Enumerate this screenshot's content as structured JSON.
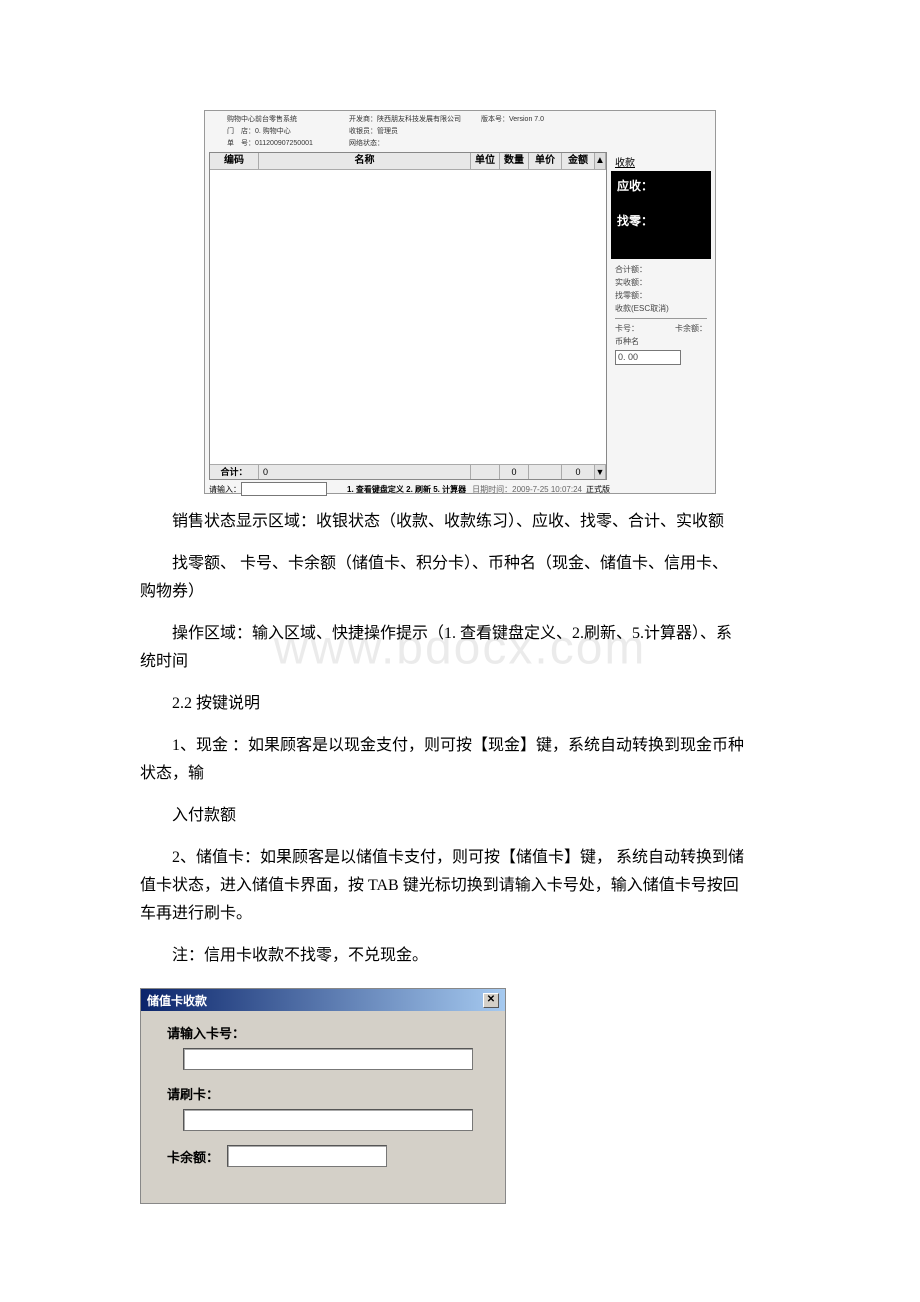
{
  "pos": {
    "header": {
      "sys_label": "购物中心前台零售系统",
      "store_label": "门　店：",
      "store_value": "0. 购物中心",
      "bill_label": "单　号：",
      "bill_value": "011200907250001",
      "dev_label": "开发商：",
      "dev_value": "陕西朋友科技发展有限公司",
      "cashier_label": "收银员：",
      "cashier_value": "管理员",
      "net_label": "网络状态：",
      "ver_label": "版本号：",
      "ver_value": "Version 7.0"
    },
    "grid": {
      "head": {
        "code": "编码",
        "name": "名称",
        "unit": "单位",
        "qty": "数量",
        "price": "单价",
        "amount": "金额"
      },
      "foot": {
        "total_label": "合计：",
        "total_qty": "0",
        "total_mid": "0",
        "total_amt": "0"
      }
    },
    "right": {
      "receipt_title": "收款",
      "due_label": "应收：",
      "change_label": "找零：",
      "sum_label": "合计额：",
      "paid_label": "实收额：",
      "chg_label": "找零额：",
      "pay_hint": "收款(ESC取消)",
      "card_no_label": "卡号：",
      "card_bal_label": "卡余额：",
      "currency_label": "币种名",
      "input_value": "0. 00"
    },
    "bottom": {
      "input_label": "请输入：",
      "hints": "1. 查看键盘定义  2. 刷新  5. 计算器",
      "time_label": "日期时间：",
      "time_value": "2009-7-25 10:07:24",
      "edition": "正式版"
    }
  },
  "paras": {
    "p1": "销售状态显示区域：收银状态（收款、收款练习）、应收、找零、合计、实收额",
    "p2a": "找零额、 卡号、卡余额（储值卡、积分卡）、币种名（现金、储值卡、信用卡、",
    "p2b": "购物券）",
    "p3a": "操作区域：输入区域、快捷操作提示（1. 查看键盘定义、2.刷新、5.计算器）、系",
    "p3b": "统时间",
    "p4": "2.2 按键说明",
    "p5a": "1、现金 ：如果顾客是以现金支付，则可按【现金】键，系统自动转换到现金币种",
    "p5b": "状态，输",
    "p6": " 入付款额",
    "p7a": "2、储值卡：如果顾客是以储值卡支付，则可按【储值卡】键， 系统自动转换到储",
    "p7b": "值卡状态，进入储值卡界面，按 TAB 键光标切换到请输入卡号处，输入储值卡号按回",
    "p7c": "车再进行刷卡。",
    "p8": "注：信用卡收款不找零，不兑现金。"
  },
  "watermark": "www.bdocx.com",
  "dialog": {
    "title": "储值卡收款",
    "close": "✕",
    "card_no_label": "请输入卡号：",
    "swipe_label": "请刷卡：",
    "balance_label": "卡余额："
  }
}
